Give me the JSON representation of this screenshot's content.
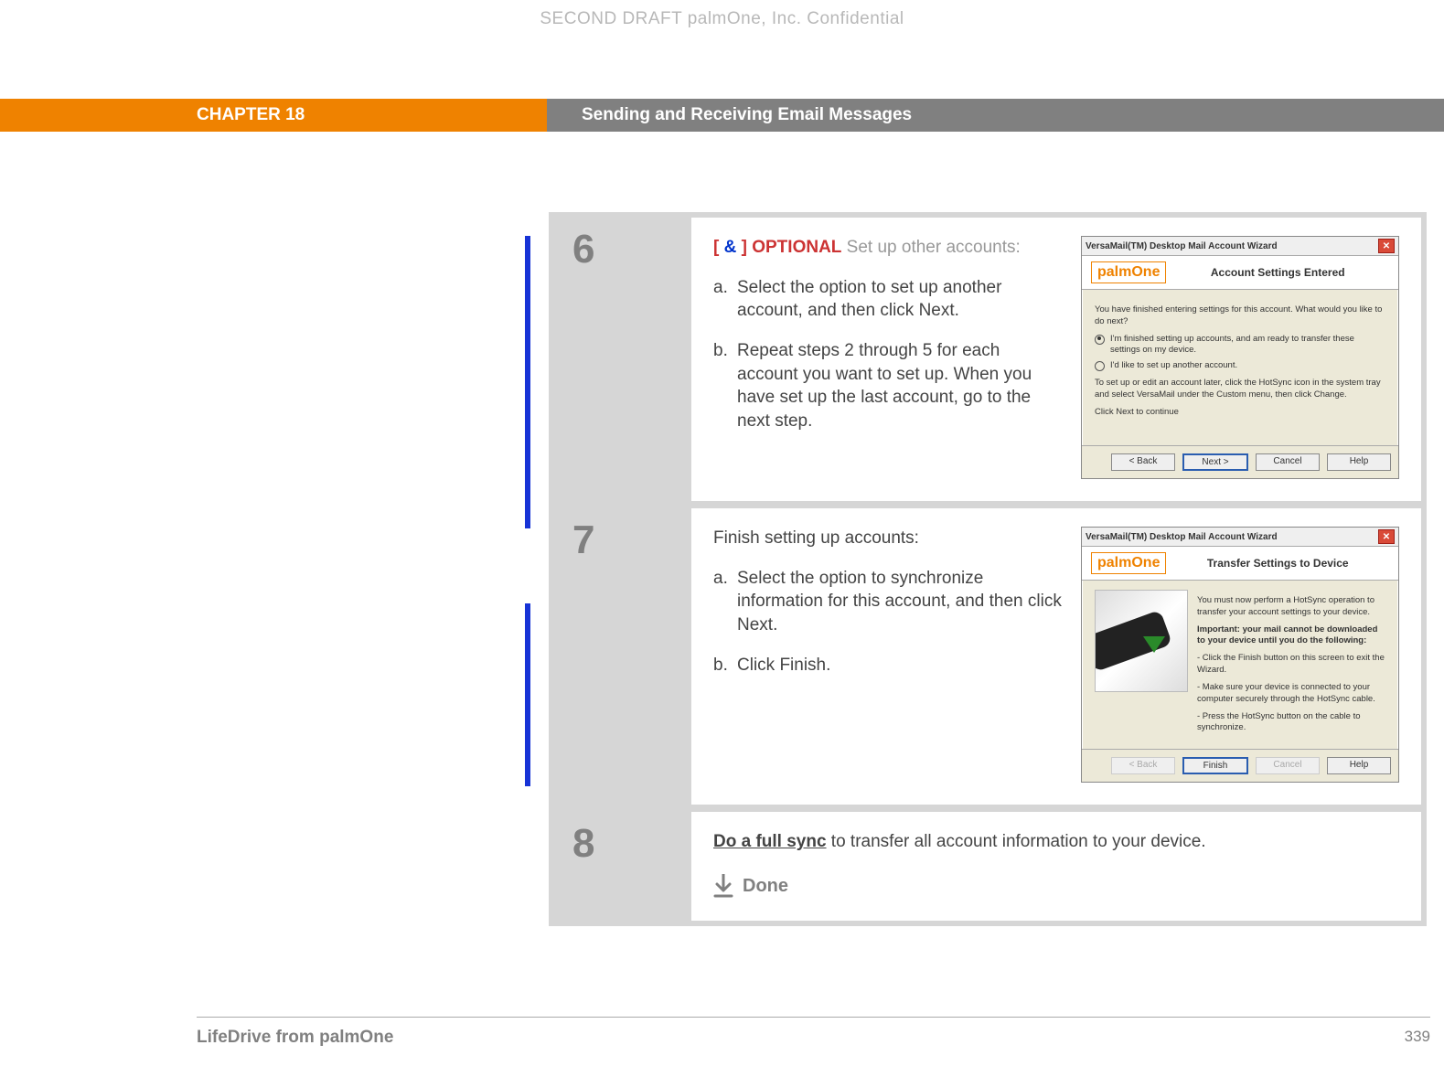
{
  "header": {
    "confidential": "SECOND DRAFT palmOne, Inc.  Confidential",
    "chapter_label": "CHAPTER 18",
    "chapter_title": "Sending and Receiving Email Messages"
  },
  "steps": [
    {
      "num": "6",
      "optional_prefix_open": "[ ",
      "optional_amp": "&",
      "optional_prefix_close": " ]",
      "optional_word": " OPTIONAL",
      "optional_tail": "   Set up other accounts:",
      "items": [
        {
          "letter": "a.",
          "text": "Select the option to set up another account, and then click Next."
        },
        {
          "letter": "b.",
          "text": "Repeat steps 2 through 5 for each account you want to set up. When you have set up the last account, go to the next step."
        }
      ],
      "wizard": {
        "title": "VersaMail(TM) Desktop Mail Account Wizard",
        "logo": "palmOne",
        "header_title": "Account Settings Entered",
        "intro": "You have finished entering settings for this account. What would you like to do next?",
        "radio1": "I'm finished setting up accounts, and am ready to transfer these settings on my device.",
        "radio2": "I'd like to set up another account.",
        "note": "To set up or edit an account later, click the HotSync icon in the system tray and select VersaMail under the Custom menu, then click Change.",
        "continue": "Click Next to continue",
        "buttons": {
          "back": "< Back",
          "next": "Next >",
          "cancel": "Cancel",
          "help": "Help"
        }
      }
    },
    {
      "num": "7",
      "lead": "Finish setting up accounts:",
      "items": [
        {
          "letter": "a.",
          "text": "Select the option to synchronize information for this account, and then click Next."
        },
        {
          "letter": "b.",
          "text": "Click Finish."
        }
      ],
      "wizard": {
        "title": "VersaMail(TM) Desktop Mail Account Wizard",
        "logo": "palmOne",
        "header_title": "Transfer Settings to Device",
        "line1": "You must now perform a HotSync operation to transfer your account settings to your device.",
        "line2_bold": "Important: your mail cannot be downloaded to your device until you do the following:",
        "bul1": "- Click the Finish button on this screen to exit the Wizard.",
        "bul2": "- Make sure your device is connected to your computer securely through the HotSync cable.",
        "bul3": "- Press the HotSync button on the cable to synchronize.",
        "buttons": {
          "back": "< Back",
          "finish": "Finish",
          "cancel": "Cancel",
          "help": "Help"
        }
      }
    },
    {
      "num": "8",
      "link_text": "Do a full sync",
      "rest": " to transfer all account information to your device.",
      "done": "Done"
    }
  ],
  "footer": {
    "left": "LifeDrive from palmOne",
    "right": "339"
  }
}
